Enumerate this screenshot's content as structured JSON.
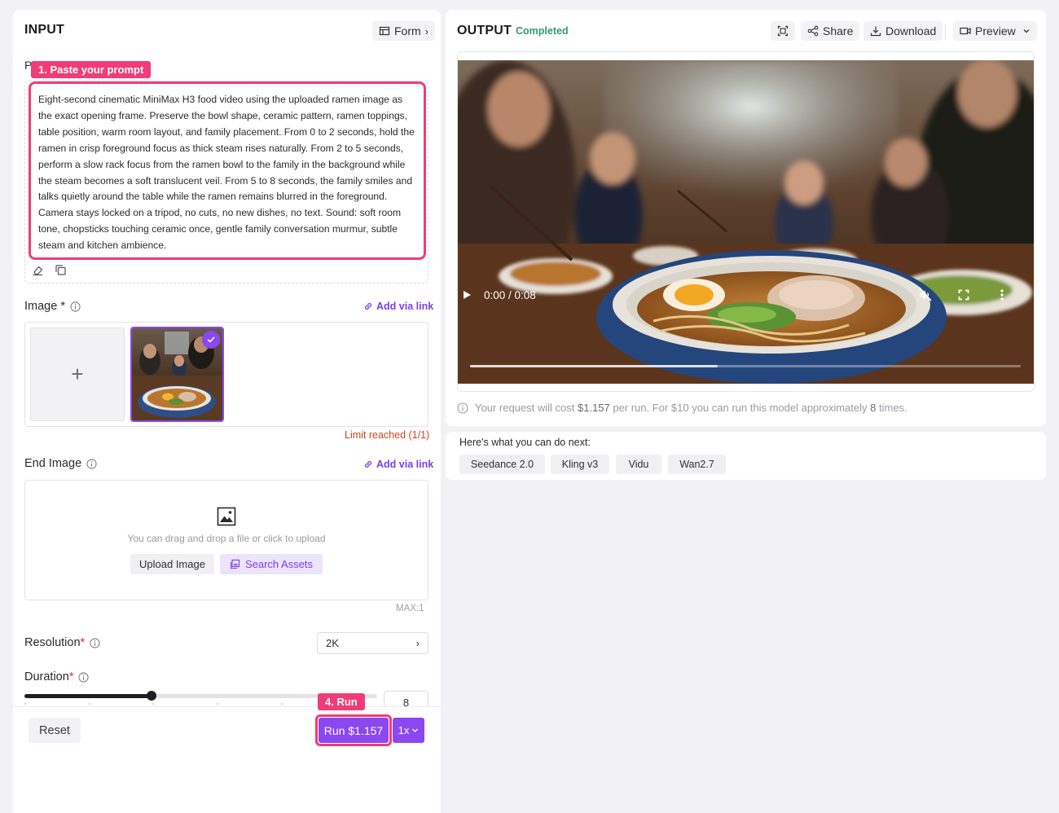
{
  "input": {
    "title": "INPUT",
    "form_label": "Form",
    "prompt_label_partial": "P",
    "prompt_annotation": "1. Paste your prompt",
    "prompt_text": "Eight-second cinematic MiniMax H3 food video using the uploaded ramen image as the exact opening frame. Preserve the bowl shape, ceramic pattern, ramen toppings, table position, warm room layout, and family placement. From 0 to 2 seconds, hold the ramen in crisp foreground focus as thick steam rises naturally. From 2 to 5 seconds, perform a slow rack focus from the ramen bowl to the family in the background while the steam becomes a soft translucent veil. From 5 to 8 seconds, the family smiles and talks quietly around the table while the ramen remains blurred in the foreground. Camera stays locked on a tripod, no cuts, no new dishes, no text. Sound: soft room tone, chopsticks touching ceramic once, gentle family conversation murmur, subtle steam and kitchen ambience.",
    "image": {
      "label": "Image",
      "required_mark": "*",
      "add_link": "Add via link",
      "add_tile": "+",
      "limit_text": "Limit reached (1/1)"
    },
    "end_image": {
      "label": "End Image",
      "add_link": "Add via link",
      "upload_hint": "You can drag and drop a file or click to upload",
      "upload_button": "Upload Image",
      "search_button": "Search Assets",
      "max_text": "MAX:1"
    },
    "resolution": {
      "label": "Resolution",
      "required_mark": "*",
      "value": "2K"
    },
    "duration": {
      "label": "Duration",
      "required_mark": "*",
      "value": "8",
      "slider_fraction": 0.36
    },
    "reset_button": "Reset",
    "run_annotation": "4. Run",
    "run_button": "Run $1.157",
    "multiplier": "1x"
  },
  "output": {
    "title": "OUTPUT",
    "status": "Completed",
    "share_button": "Share",
    "download_button": "Download",
    "preview_button": "Preview",
    "video_time": "0:00 / 0:08",
    "buffer_fraction": 0.45,
    "cost_pre": "Your request will cost ",
    "cost_value": "$1.157",
    "cost_mid": " per run. For $10 you can run this model approximately ",
    "cost_count": "8",
    "cost_post": " times."
  },
  "next": {
    "text": "Here's what you can do next:",
    "models": [
      "Seedance 2.0",
      "Kling v3",
      "Vidu",
      "Wan2.7"
    ]
  },
  "colors": {
    "accent": "#8b47f0",
    "annotation": "#f23c77",
    "status_green": "#2f9a6a",
    "warning": "#d2451f"
  }
}
